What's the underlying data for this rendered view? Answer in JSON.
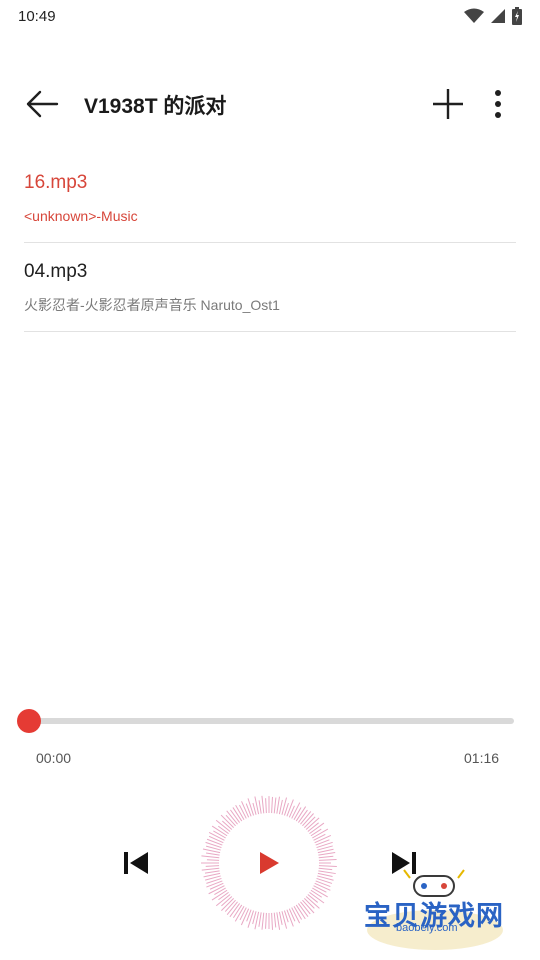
{
  "status_bar": {
    "time": "10:49"
  },
  "header": {
    "title": "V1938T 的派对"
  },
  "tracks": [
    {
      "title": "16.mp3",
      "subtitle": "<unknown>-Music",
      "active": true
    },
    {
      "title": "04.mp3",
      "subtitle": "火影忍者-火影忍者原声音乐 Naruto_Ost1",
      "active": false
    }
  ],
  "player": {
    "elapsed": "00:00",
    "duration": "01:16",
    "progress": 0.0
  },
  "watermark": {
    "text": "宝贝游戏网",
    "url": "baobeiy.com"
  },
  "colors": {
    "accent": "#d7463a",
    "thumb": "#e53b34",
    "play": "#d93a2f",
    "ring": "#e8a8c4"
  }
}
